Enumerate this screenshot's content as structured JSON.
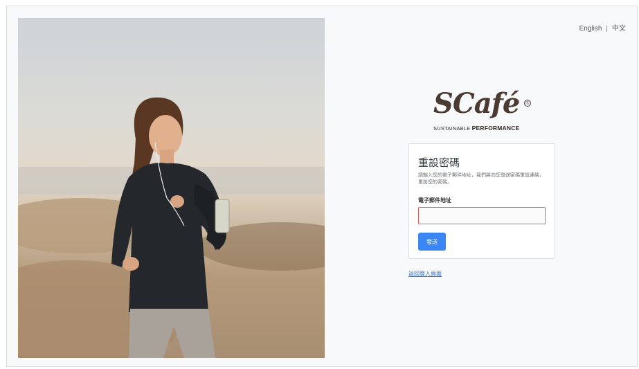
{
  "language_switch": {
    "english": "English",
    "separator": "|",
    "chinese": "中文"
  },
  "brand": {
    "logo_text": "SCafé",
    "registered_mark": "®",
    "tagline_prefix": "SUSTAINABLE",
    "tagline_main": "PERFORMANCE",
    "colors": {
      "logo": "#4a3a32"
    }
  },
  "reset_form": {
    "title": "重設密碼",
    "description": "請輸入您的電子郵件地址，我們將向您發送密碼重設連結，重設您的密碼。",
    "email_label": "電子郵件地址",
    "email_value": "",
    "email_placeholder": "",
    "submit_label": "發送",
    "colors": {
      "button": "#3a86f4",
      "input_border_error": "#e25a5a"
    }
  },
  "back_link": "返回登入頁面",
  "hero_image": {
    "subject": "woman-jogging-on-beach-photo"
  }
}
